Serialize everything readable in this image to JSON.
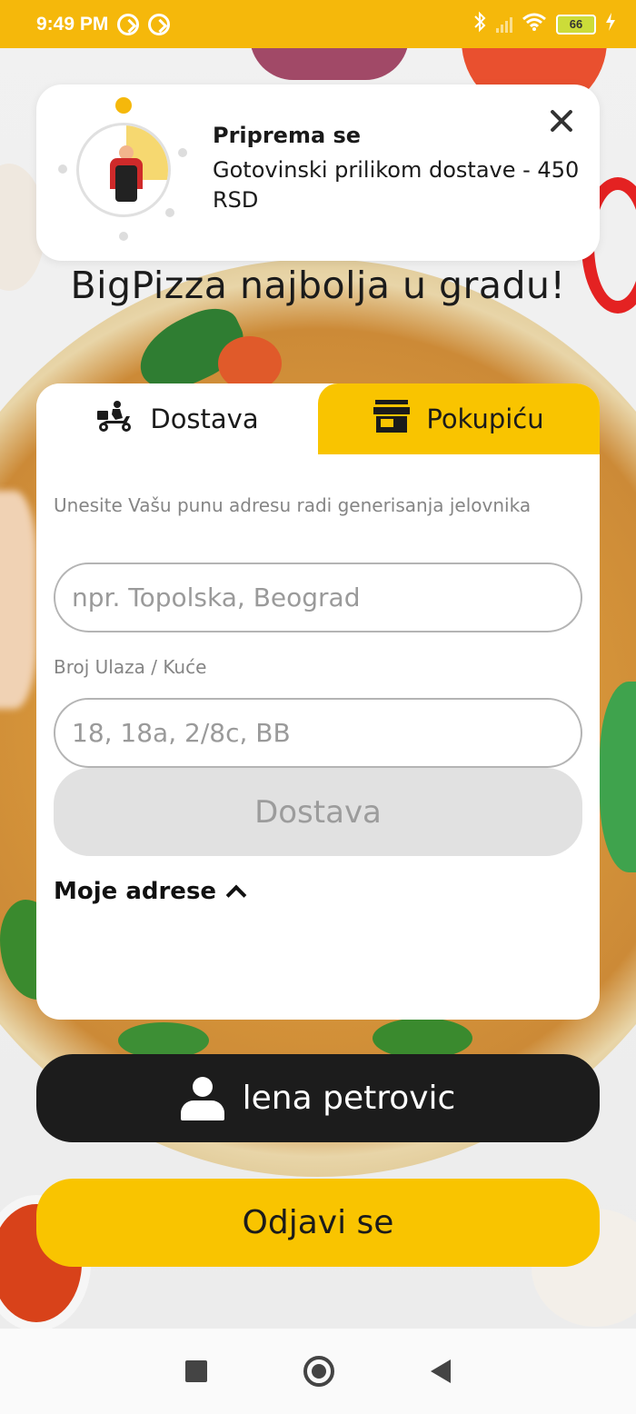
{
  "status_bar": {
    "time": "9:49 PM",
    "battery_level": "66",
    "icons": [
      "app-notification-icon",
      "app-notification-icon",
      "bluetooth-icon",
      "signal-icon",
      "wifi-icon",
      "battery-icon",
      "charging-icon"
    ]
  },
  "notification": {
    "title": "Priprema se",
    "body": "Gotovinski prilikom dostave - 450 RSD",
    "progress_step": 2,
    "progress_steps_total": 5
  },
  "tagline": "BigPizza najbolja u gradu!",
  "tabs": {
    "delivery_label": "Dostava",
    "pickup_label": "Pokupiću",
    "active": "delivery"
  },
  "form": {
    "address_label": "Unesite Vašu punu adresu radi generisanja jelovnika",
    "address_placeholder": "npr. Topolska, Beograd",
    "address_value": "",
    "entrance_label": "Broj Ulaza / Kuće",
    "entrance_placeholder": "18, 18a, 2/8c, BB",
    "entrance_value": "",
    "submit_label": "Dostava"
  },
  "my_addresses_label": "Moje adrese",
  "user": {
    "name": "lena petrovic"
  },
  "logout_label": "Odjavi se",
  "colors": {
    "brand_yellow": "#f9c400",
    "status_bar": "#f5b80b",
    "dark_button": "#1c1c1c",
    "disabled_button": "#e1e1e1"
  }
}
